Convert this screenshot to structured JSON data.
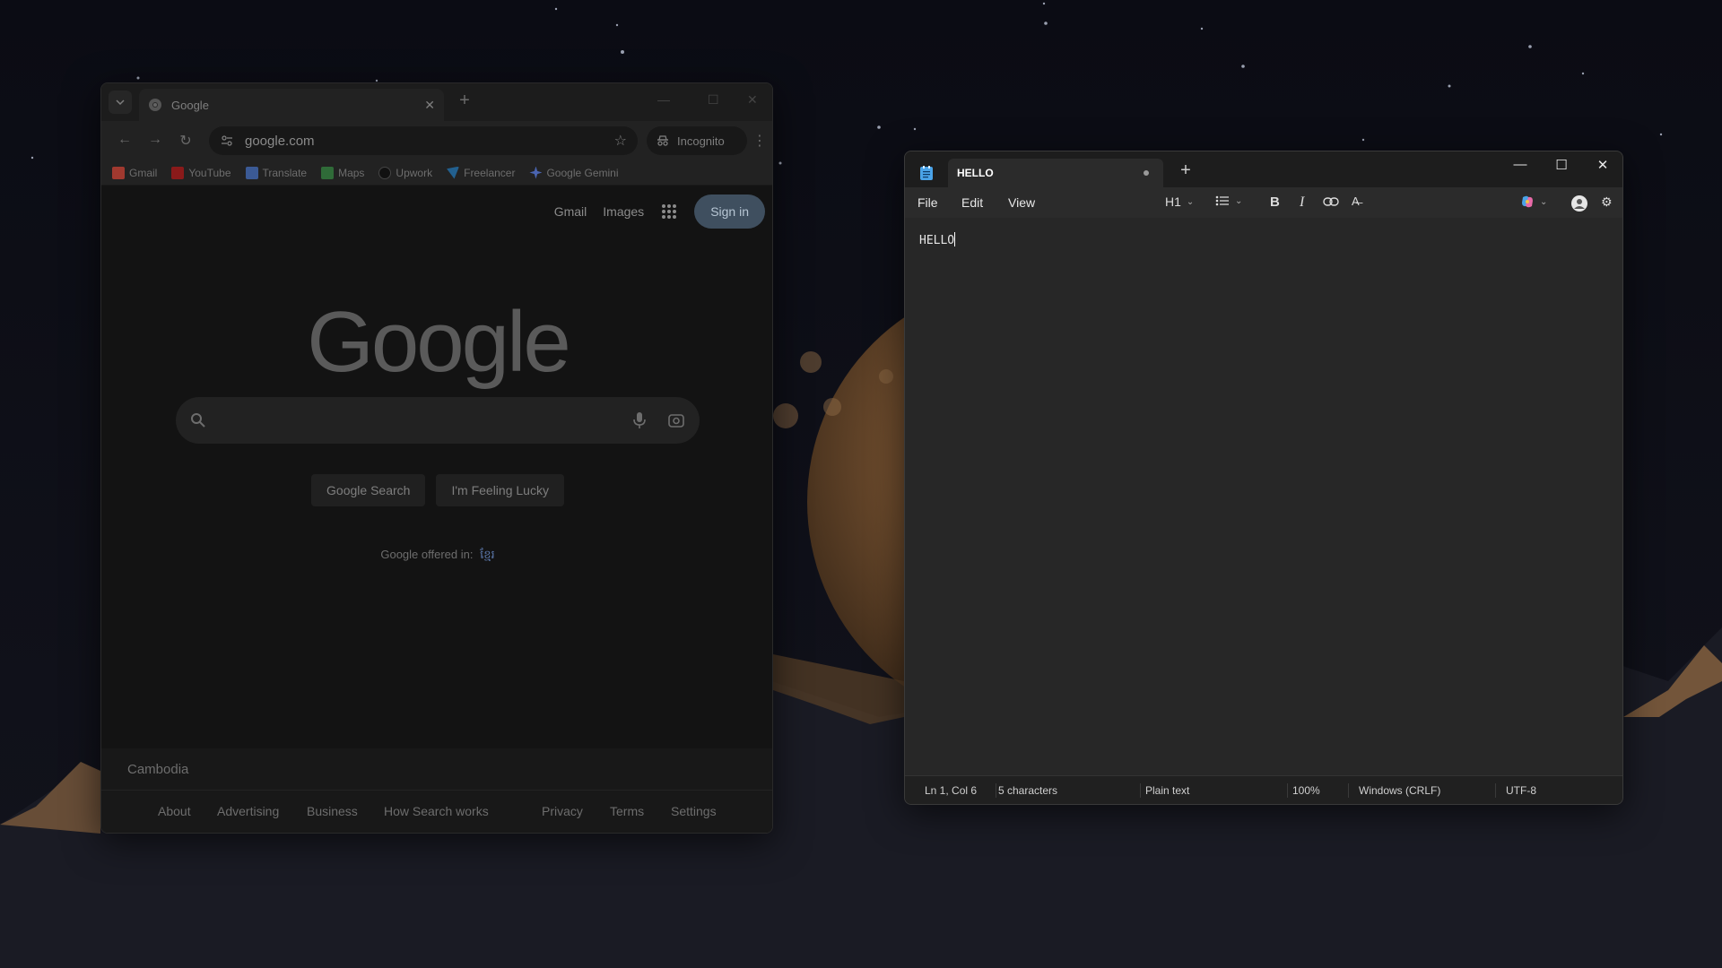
{
  "chrome": {
    "tab": {
      "title": "Google",
      "favicon_icon": "chrome-icon",
      "close_icon": "close-icon"
    },
    "address": {
      "url": "google.com",
      "incognito_label": "Incognito"
    },
    "bookmarks": [
      {
        "label": "Gmail",
        "icon": "gmail-icon",
        "color": "#c5221f"
      },
      {
        "label": "YouTube",
        "icon": "youtube-icon",
        "color": "#cc0000"
      },
      {
        "label": "Translate",
        "icon": "translate-icon",
        "color": "#4a72c4"
      },
      {
        "label": "Maps",
        "icon": "maps-icon",
        "color": "#3a9a4a"
      },
      {
        "label": "Upwork",
        "icon": "upwork-icon",
        "color": "#222222"
      },
      {
        "label": "Freelancer",
        "icon": "freelancer-icon",
        "color": "#2d8ad0"
      },
      {
        "label": "Google Gemini",
        "icon": "gemini-icon",
        "color": "#5a7ad8"
      }
    ],
    "page": {
      "nav_gmail": "Gmail",
      "nav_images": "Images",
      "signin_label": "Sign in",
      "logo": "Google",
      "search_button": "Google Search",
      "lucky_button": "I'm Feeling Lucky",
      "offered_in": "Google offered in:",
      "offered_language": "ខ្មែរ",
      "country": "Cambodia",
      "footer_links": [
        "About",
        "Advertising",
        "Business",
        "How Search works",
        "Privacy",
        "Terms",
        "Settings"
      ]
    }
  },
  "notepad": {
    "tab_title": "HELLO",
    "menus": [
      "File",
      "Edit",
      "View"
    ],
    "heading_label": "H1",
    "content": "HELLO",
    "status": {
      "position": "Ln 1, Col 6",
      "characters": "5 characters",
      "format": "Plain text",
      "zoom": "100%",
      "line_ending": "Windows (CRLF)",
      "encoding": "UTF-8"
    }
  },
  "colors": {
    "desktop_bg": "#0d0e16",
    "planet": "#8a6440",
    "chrome_signin": "#3f4f5f",
    "notepad_accent": "#4aa3e8"
  }
}
